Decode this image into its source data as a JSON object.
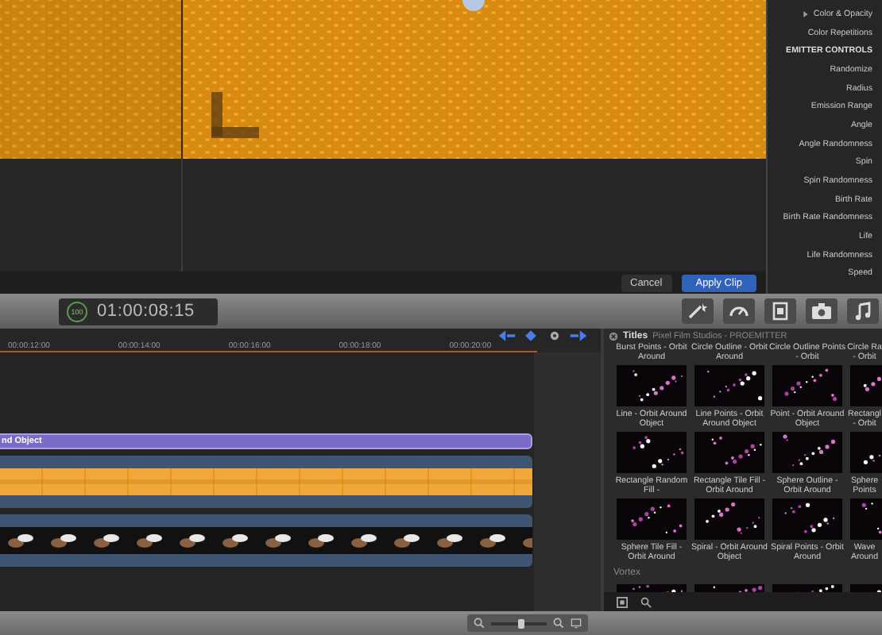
{
  "viewer": {
    "buttons": [
      {
        "label": "Cancel",
        "primary": false
      },
      {
        "label": "Apply Clip",
        "primary": true
      }
    ]
  },
  "inspector": {
    "items": [
      {
        "kind": "group",
        "label": "Color & Opacity",
        "expanded": false
      },
      {
        "kind": "param",
        "label": "Color Repetitions"
      },
      {
        "kind": "heading",
        "label": "EMITTER CONTROLS"
      },
      {
        "kind": "param",
        "label": "Randomize"
      },
      {
        "kind": "param",
        "label": "Radius"
      },
      {
        "kind": "param",
        "label": "Emission Range"
      },
      {
        "kind": "param",
        "label": "Angle"
      },
      {
        "kind": "param",
        "label": "Angle Randomness"
      },
      {
        "kind": "param",
        "label": "Spin"
      },
      {
        "kind": "param",
        "label": "Spin Randomness"
      },
      {
        "kind": "param",
        "label": "Birth Rate"
      },
      {
        "kind": "param",
        "label": "Birth Rate Randomness"
      },
      {
        "kind": "param",
        "label": "Life"
      },
      {
        "kind": "param",
        "label": "Life Randomness"
      },
      {
        "kind": "param",
        "label": "Speed"
      }
    ]
  },
  "timecode": {
    "badge": "100",
    "value": "01:00:08:15"
  },
  "timeline": {
    "ruler": [
      "00:00:12:00",
      "00:00:14:00",
      "00:00:16:00",
      "00:00:18:00",
      "00:00:20:00"
    ],
    "clips": [
      {
        "kind": "title",
        "label": "nd Object"
      },
      {
        "kind": "video"
      },
      {
        "kind": "video"
      }
    ]
  },
  "browser": {
    "category": "Titles",
    "path": "Pixel Film Studios - PROEMITTER",
    "rows": [
      [
        {
          "kind": "label",
          "label": "Burst Points - Orbit Around"
        },
        {
          "kind": "label",
          "label": "Circle Outline - Orbit Around"
        },
        {
          "kind": "label",
          "label": "Circle Outline Points - Orbit"
        },
        {
          "kind": "label",
          "label": "Circle Ra - Orbit"
        }
      ],
      [
        {
          "kind": "preset",
          "label": "Line - Orbit Around Object"
        },
        {
          "kind": "preset",
          "label": "Line Points - Orbit Around Object"
        },
        {
          "kind": "preset",
          "label": "Point - Orbit Around Object"
        },
        {
          "kind": "preset",
          "label": "Rectangl - Orbit"
        }
      ],
      [
        {
          "kind": "preset",
          "label": "Rectangle Random Fill -"
        },
        {
          "kind": "preset",
          "label": "Rectangle Tile Fill - Orbit Around"
        },
        {
          "kind": "preset",
          "label": "Sphere Outline - Orbit Around"
        },
        {
          "kind": "preset",
          "label": "Sphere Points"
        }
      ],
      [
        {
          "kind": "preset",
          "label": "Sphere Tile Fill - Orbit Around"
        },
        {
          "kind": "preset",
          "label": "Spiral - Orbit Around Object"
        },
        {
          "kind": "preset",
          "label": "Spiral Points - Orbit Around"
        },
        {
          "kind": "preset",
          "label": "Wave Around"
        }
      ]
    ],
    "sections": [
      {
        "label": "Vortex",
        "items": [
          {
            "kind": "preset"
          },
          {
            "kind": "preset"
          },
          {
            "kind": "preset"
          },
          {
            "kind": "preset"
          }
        ]
      }
    ]
  },
  "zoom": {
    "level": 0.55
  }
}
